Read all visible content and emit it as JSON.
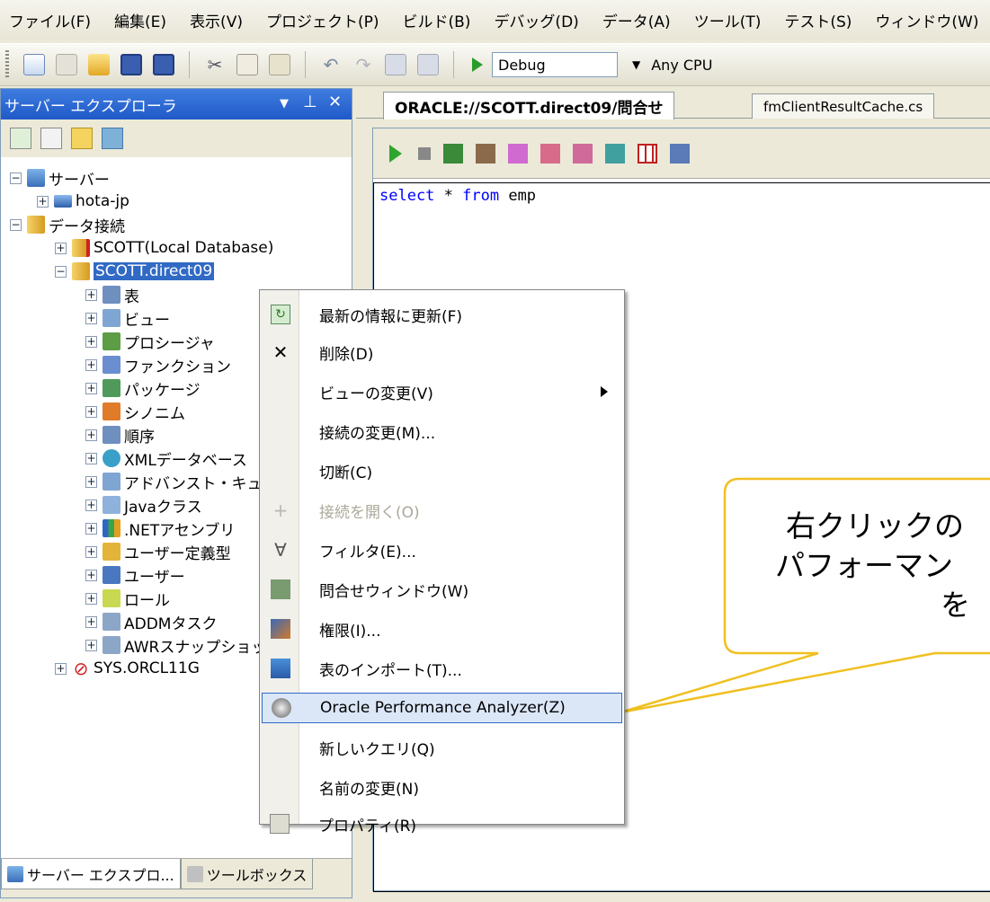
{
  "menubar": {
    "items": [
      "ファイル(F)",
      "編集(E)",
      "表示(V)",
      "プロジェクト(P)",
      "ビルド(B)",
      "デバッグ(D)",
      "データ(A)",
      "ツール(T)",
      "テスト(S)",
      "ウィンドウ(W)"
    ]
  },
  "toolbar": {
    "config": "Debug",
    "platform": "Any CPU"
  },
  "server_explorer": {
    "title": "サーバー エクスプローラ",
    "tree": {
      "servers": "サーバー",
      "host": "hota-jp",
      "data_connections": "データ接続",
      "conn_local": "SCOTT(Local Database)",
      "conn_direct": "SCOTT.direct09",
      "children": [
        "表",
        "ビュー",
        "プロシージャ",
        "ファンクション",
        "パッケージ",
        "シノニム",
        "順序",
        "XMLデータベース",
        "アドバンスト・キュー",
        "Javaクラス",
        ".NETアセンブリ",
        "ユーザー定義型",
        "ユーザー",
        "ロール",
        "ADDMタスク",
        "AWRスナップショット"
      ],
      "conn_sys": "SYS.ORCL11G"
    },
    "bottom_tabs": {
      "server_explorer": "サーバー エクスプロ...",
      "toolbox": "ツールボックス"
    }
  },
  "editor": {
    "tabs": {
      "active": "ORACLE://SCOTT.direct09/問合せ",
      "other": "fmClientResultCache.cs"
    },
    "code": {
      "kw1": "select",
      "rest1": " * ",
      "kw2": "from",
      "rest2": " emp"
    }
  },
  "context_menu": {
    "items": [
      {
        "label": "最新の情報に更新(F)",
        "icon": "refresh-icon"
      },
      {
        "label": "削除(D)",
        "icon": "delete-icon"
      },
      {
        "label": "ビューの変更(V)",
        "icon": ""
      },
      {
        "label": "接続の変更(M)...",
        "icon": ""
      },
      {
        "label": "切断(C)",
        "icon": ""
      },
      {
        "label": "接続を開く(O)",
        "icon": "plus-icon",
        "disabled": true
      },
      {
        "label": "フィルタ(E)...",
        "icon": "filter-icon"
      },
      {
        "label": "問合せウィンドウ(W)",
        "icon": "query-window-icon"
      },
      {
        "label": "権限(I)...",
        "icon": "privileges-icon"
      },
      {
        "label": "表のインポート(T)...",
        "icon": "import-icon"
      },
      {
        "label": "Oracle Performance Analyzer(Z)",
        "icon": "performance-analyzer-icon",
        "highlighted": true
      },
      {
        "label": "新しいクエリ(Q)",
        "icon": ""
      },
      {
        "label": "名前の変更(N)",
        "icon": ""
      },
      {
        "label": "プロパティ(R)",
        "icon": "properties-icon"
      }
    ]
  },
  "callout": {
    "line1": "右クリックの",
    "line2": "パフォーマン",
    "line3": "を"
  },
  "colors": {
    "title_blue": "#2059c8",
    "selection": "#316ac5",
    "callout_border": "#f0c020",
    "keyword": "#0000ff"
  }
}
